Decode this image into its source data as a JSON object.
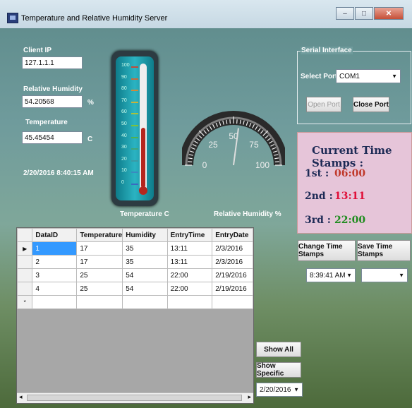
{
  "window": {
    "title": "Temperature and Relative Humidity  Server",
    "btn_min": "–",
    "btn_max": "□",
    "btn_close": "✕"
  },
  "fields": {
    "client_ip_label": "Client IP",
    "client_ip": "127.1.1.1",
    "humidity_label": "Relative Humidity",
    "humidity": "54.20568",
    "humidity_unit": "%",
    "temperature_label": "Temperature",
    "temperature": "45.45454",
    "temperature_unit": "C",
    "datetime": "2/20/2016 8:40:15 AM"
  },
  "thermometer": {
    "caption": "Temperature  C",
    "ticks": [
      "100",
      "90",
      "80",
      "70",
      "60",
      "50",
      "40",
      "30",
      "20",
      "10",
      "0"
    ],
    "level_fraction": 0.45
  },
  "gauge": {
    "caption": "Relative Humidity  %",
    "ticks": [
      "0",
      "25",
      "50",
      "75",
      "100"
    ],
    "value": 54.2
  },
  "serial": {
    "group_label": "Serial Interface",
    "port_label": "Select Port :",
    "port_value": "COM1",
    "open_label": "Open Port",
    "close_label": "Close Port"
  },
  "stamps": {
    "title": "Current Time Stamps :",
    "rows": [
      {
        "label": "1st :",
        "value": "06:00",
        "color": "#c0392b"
      },
      {
        "label": "2nd :",
        "value": "13:11",
        "color": "#e0103a"
      },
      {
        "label": "3rd :",
        "value": "22:00",
        "color": "#1e8c1e"
      }
    ],
    "change_label": "Change Time Stamps",
    "save_label": "Save Time Stamps",
    "time_value": "8:39:41 AM",
    "slot_value": ""
  },
  "grid": {
    "columns": [
      "DataID",
      "Temperature",
      "Humidity",
      "EntryTime",
      "EntryDate"
    ],
    "rows": [
      [
        "1",
        "17",
        "35",
        "13:11",
        "2/3/2016"
      ],
      [
        "2",
        "17",
        "35",
        "13:11",
        "2/3/2016"
      ],
      [
        "3",
        "25",
        "54",
        "22:00",
        "2/19/2016"
      ],
      [
        "4",
        "25",
        "54",
        "22:00",
        "2/19/2016"
      ]
    ]
  },
  "actions": {
    "show_all": "Show All",
    "show_specific": "Show Specific",
    "date_value": "2/20/2016"
  }
}
